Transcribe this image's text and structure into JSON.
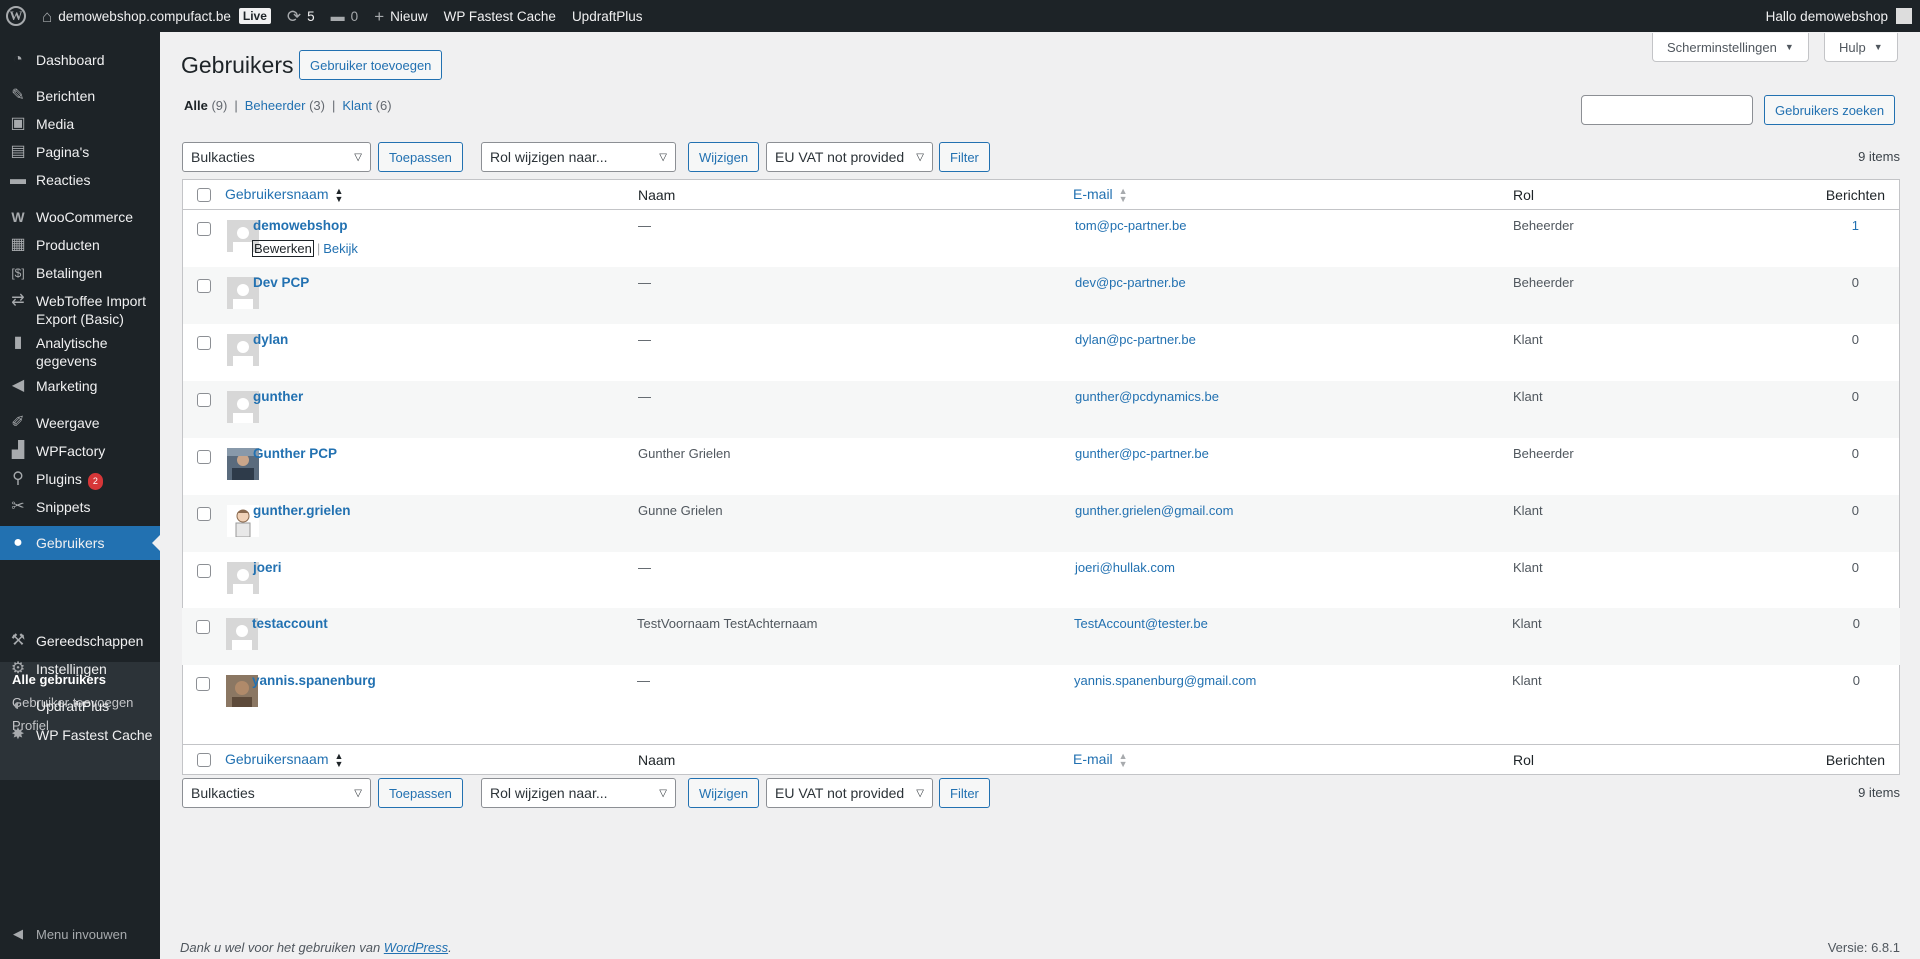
{
  "adminbar": {
    "site_name": "demowebshop.compufact.be",
    "live_label": "Live",
    "updates_count": "5",
    "comments_count": "0",
    "new_label": "Nieuw",
    "fastest_cache_label": "WP Fastest Cache",
    "updraft_label": "UpdraftPlus",
    "greeting": "Hallo demowebshop"
  },
  "sidebar": {
    "items": [
      {
        "label": "Dashboard",
        "icon": "dashboard-icon"
      },
      {
        "label": "Berichten",
        "icon": "pin-icon"
      },
      {
        "label": "Media",
        "icon": "media-icon"
      },
      {
        "label": "Pagina's",
        "icon": "page-icon"
      },
      {
        "label": "Reacties",
        "icon": "comment-icon"
      },
      {
        "label": "WooCommerce",
        "icon": "woocommerce-icon"
      },
      {
        "label": "Producten",
        "icon": "products-icon"
      },
      {
        "label": "Betalingen",
        "icon": "payments-icon"
      },
      {
        "label": "WebToffee Import Export (Basic)",
        "icon": "import-export-icon"
      },
      {
        "label": "Analytische gegevens",
        "icon": "analytics-icon"
      },
      {
        "label": "Marketing",
        "icon": "megaphone-icon"
      },
      {
        "label": "Weergave",
        "icon": "brush-icon"
      },
      {
        "label": "WPFactory",
        "icon": "factory-icon"
      },
      {
        "label": "Plugins",
        "icon": "plugin-icon",
        "badge": "2"
      },
      {
        "label": "Snippets",
        "icon": "snippets-icon"
      },
      {
        "label": "Gebruikers",
        "icon": "users-icon"
      },
      {
        "label": "Gereedschappen",
        "icon": "wrench-icon"
      },
      {
        "label": "Instellingen",
        "icon": "settings-icon"
      },
      {
        "label": "UpdraftPlus",
        "icon": "updraft-icon"
      },
      {
        "label": "WP Fastest Cache",
        "icon": "cheetah-icon"
      }
    ],
    "submenu": [
      "Alle gebruikers",
      "Gebruiker toevoegen",
      "Profiel"
    ],
    "collapse_label": "Menu invouwen"
  },
  "header": {
    "screen_options": "Scherminstellingen",
    "help": "Hulp",
    "title": "Gebruikers",
    "add_button": "Gebruiker toevoegen",
    "search_button": "Gebruikers zoeken"
  },
  "filters": {
    "all_label": "Alle",
    "all_count": "(9)",
    "admin_label": "Beheerder",
    "admin_count": "(3)",
    "client_label": "Klant",
    "client_count": "(6)"
  },
  "toolbar": {
    "bulk_actions": "Bulkacties",
    "apply": "Toepassen",
    "change_role": "Rol wijzigen naar...",
    "change": "Wijzigen",
    "vat_filter": "EU VAT not provided",
    "filter": "Filter",
    "items_count": "9 items"
  },
  "table": {
    "columns": {
      "username": "Gebruikersnaam",
      "name": "Naam",
      "email": "E-mail",
      "role": "Rol",
      "posts": "Berichten"
    },
    "row_actions": {
      "edit": "Bewerken",
      "view": "Bekijk"
    },
    "rows": [
      {
        "username": "demowebshop",
        "name": "—",
        "email": "tom@pc-partner.be",
        "role": "Beheerder",
        "posts": "1"
      },
      {
        "username": "Dev PCP",
        "name": "—",
        "email": "dev@pc-partner.be",
        "role": "Beheerder",
        "posts": "0"
      },
      {
        "username": "dylan",
        "name": "—",
        "email": "dylan@pc-partner.be",
        "role": "Klant",
        "posts": "0"
      },
      {
        "username": "gunther",
        "name": "—",
        "email": "gunther@pcdynamics.be",
        "role": "Klant",
        "posts": "0"
      },
      {
        "username": "Gunther PCP",
        "name": "Gunther Grielen",
        "email": "gunther@pc-partner.be",
        "role": "Beheerder",
        "posts": "0"
      },
      {
        "username": "gunther.grielen",
        "name": "Gunne Grielen",
        "email": "gunther.grielen@gmail.com",
        "role": "Klant",
        "posts": "0"
      },
      {
        "username": "joeri",
        "name": "—",
        "email": "joeri@hullak.com",
        "role": "Klant",
        "posts": "0"
      },
      {
        "username": "testaccount",
        "name": "TestVoornaam TestAchternaam",
        "email": "TestAccount@tester.be",
        "role": "Klant",
        "posts": "0"
      },
      {
        "username": "yannis.spanenburg",
        "name": "—",
        "email": "yannis.spanenburg@gmail.com",
        "role": "Klant",
        "posts": "0"
      }
    ]
  },
  "footer": {
    "thanks_prefix": "Dank u wel voor het gebruiken van ",
    "thanks_link": "WordPress",
    "thanks_suffix": ".",
    "version": "Versie: 6.8.1"
  },
  "colors": {
    "accent": "#2271b1",
    "adminbar_bg": "#1d2327",
    "badge_red": "#d63638"
  }
}
